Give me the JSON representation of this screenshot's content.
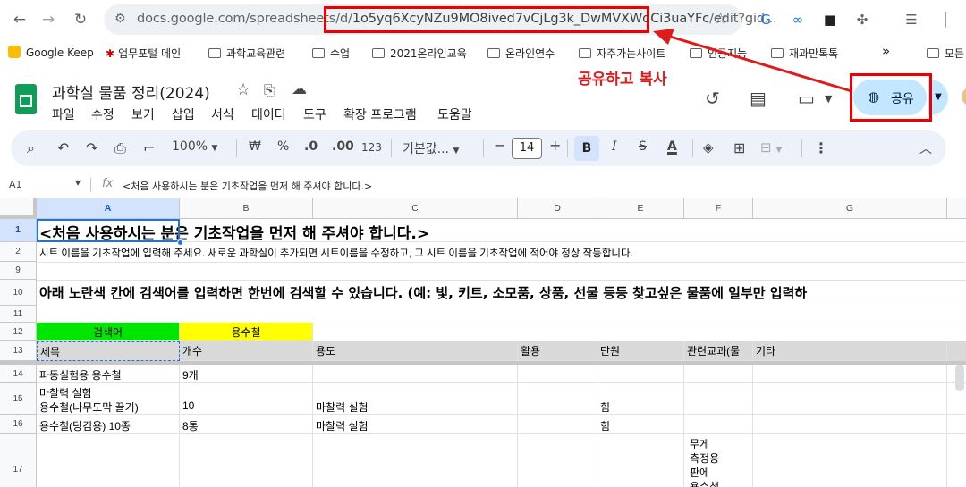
{
  "browser": {
    "url_host": "docs.google.com/spreadsheets/d/",
    "url_id": "1o5yq6XcyNZu9MO8ived7vCjLg3k_DwMVXWdCi3uaYFc",
    "url_tail": "/edit?gid...",
    "bookmarks": [
      "Google Keep",
      "업무포털 메인",
      "과학교육관련",
      "수업",
      "2021온라인교육",
      "온라인연수",
      "자주가는사이트",
      "인공지능",
      "재과만톡톡",
      "모든"
    ]
  },
  "annotation": {
    "label": "공유하고 복사",
    "color": "#e01b1b"
  },
  "sheet": {
    "title": "과학실 물품 정리(2024)",
    "menus": [
      "파일",
      "수정",
      "보기",
      "삽입",
      "서식",
      "데이터",
      "도구",
      "확장 프로그램",
      "도움말"
    ],
    "share_label": "공유"
  },
  "toolbar": {
    "zoom": "100%",
    "currency": "₩",
    "percent": "%",
    "dec_dec": ".0",
    "dec_inc": ".00",
    "number_fmt": "123",
    "font": "기본값...",
    "font_size": "14",
    "bold": "B"
  },
  "formula": {
    "cell_ref": "A1",
    "fx": "fx",
    "content": "<처음 사용하시는 분은 기초작업을 먼저 해 주셔야 합니다.>"
  },
  "grid": {
    "columns": [
      "A",
      "B",
      "C",
      "D",
      "E",
      "F",
      "G"
    ],
    "rows": {
      "r1": {
        "num": "1",
        "a": "<처음 사용하시는 분은 기초작업을 먼저 해 주셔야 합니다.>"
      },
      "r2": {
        "num": "2",
        "a": "시트 이름을 기초작업에 입력해 주세요. 새로운 과학실이 추가되면 시트이름을 수정하고, 그 시트 이름을 기초작업에 적어야 정상 작동합니다."
      },
      "r9": {
        "num": "9"
      },
      "r10": {
        "num": "10",
        "a": "아래 노란색 칸에 검색어를 입력하면 한번에 검색할 수 있습니다. (예: 빛, 키트, 소모품, 상품, 선물 등등 찾고싶은 물품에 일부만 입력하"
      },
      "r11": {
        "num": "11"
      },
      "r12": {
        "num": "12",
        "a": "검색어",
        "b": "용수철",
        "a_bg": "#00e600",
        "b_bg": "#ffff00"
      },
      "r13": {
        "num": "13",
        "a": "제목",
        "b": "개수",
        "c": "용도",
        "d": "활용",
        "e": "단원",
        "f": "관련교과(물",
        "g": "기타"
      },
      "r14": {
        "num": "14",
        "a": "파동실험용 용수철",
        "b": "9개"
      },
      "r15": {
        "num": "15",
        "a1": "마찰력 실험",
        "a2": "용수철(나무도막 끌기)",
        "b": "10",
        "c": "마찰력 실험",
        "e": "힘"
      },
      "r16": {
        "num": "16",
        "a": "용수철(당김용) 10종",
        "b": "8통",
        "c": "마찰력 실험",
        "e": "힘"
      },
      "r17": {
        "num": "17",
        "f1": "무게",
        "f2": "측정용",
        "f3": "판에",
        "f4": "용수철"
      }
    }
  }
}
